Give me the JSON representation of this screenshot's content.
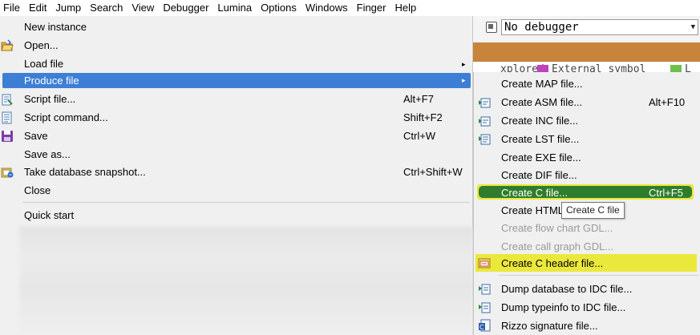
{
  "menubar": [
    "File",
    "Edit",
    "Jump",
    "Search",
    "View",
    "Debugger",
    "Lumina",
    "Options",
    "Windows",
    "Finger",
    "Help"
  ],
  "toolbar": {
    "debugger_select": "No debugger"
  },
  "background": {
    "legend_1": "xplored",
    "legend_2": "External symbol",
    "legend_3": "L"
  },
  "file_menu": {
    "items": [
      {
        "label": "New instance",
        "shortcut": "",
        "icon": "none"
      },
      {
        "label": "Open...",
        "shortcut": "",
        "icon": "open-folder-icon"
      },
      {
        "label": "Load file",
        "shortcut": "",
        "icon": "none",
        "submenu": true
      },
      {
        "label": "Produce file",
        "shortcut": "",
        "icon": "none",
        "submenu": true,
        "highlighted": true
      },
      {
        "label": "Script file...",
        "shortcut": "Alt+F7",
        "icon": "script-file-icon"
      },
      {
        "label": "Script command...",
        "shortcut": "Shift+F2",
        "icon": "script-command-icon"
      },
      {
        "label": "Save",
        "shortcut": "Ctrl+W",
        "icon": "save-icon"
      },
      {
        "label": "Save as...",
        "shortcut": "",
        "icon": "none"
      },
      {
        "label": "Take database snapshot...",
        "shortcut": "Ctrl+Shift+W",
        "icon": "snapshot-icon"
      },
      {
        "label": "Close",
        "shortcut": "",
        "icon": "none"
      },
      {
        "label": "Quick start",
        "shortcut": "",
        "icon": "none"
      }
    ],
    "submenu_arrow": "▸"
  },
  "produce_menu": {
    "items": [
      {
        "label": "Create MAP file...",
        "shortcut": "",
        "icon": "none"
      },
      {
        "label": "Create ASM file...",
        "shortcut": "Alt+F10",
        "icon": "asm-file-icon"
      },
      {
        "label": "Create INC file...",
        "shortcut": "",
        "icon": "inc-file-icon"
      },
      {
        "label": "Create LST file...",
        "shortcut": "",
        "icon": "lst-file-icon"
      },
      {
        "label": "Create EXE file...",
        "shortcut": "",
        "icon": "none"
      },
      {
        "label": "Create DIF file...",
        "shortcut": "",
        "icon": "none"
      },
      {
        "label": "Create C file...",
        "shortcut": "Ctrl+F5",
        "icon": "none",
        "highlighted": true
      },
      {
        "label": "Create HTML",
        "shortcut": "",
        "icon": "none"
      },
      {
        "label": "Create flow chart GDL...",
        "shortcut": "",
        "icon": "none",
        "disabled": true
      },
      {
        "label": "Create call graph GDL...",
        "shortcut": "",
        "icon": "none",
        "disabled": true
      },
      {
        "label": "Create C header file...",
        "shortcut": "",
        "icon": "c-header-icon",
        "marked": true
      },
      {
        "label": "Dump database to IDC file...",
        "shortcut": "",
        "icon": "dump-database-icon"
      },
      {
        "label": "Dump typeinfo to IDC file...",
        "shortcut": "",
        "icon": "dump-typeinfo-icon"
      },
      {
        "label": "Rizzo signature file...",
        "shortcut": "",
        "icon": "rizzo-icon"
      }
    ]
  },
  "tooltip": "Create C file",
  "colors": {
    "menu_highlight": "#3d7fd5",
    "green_highlight": "#2f7d2c",
    "yellow_marker": "#ebe83c",
    "toolbar_orange": "#c8843a"
  }
}
